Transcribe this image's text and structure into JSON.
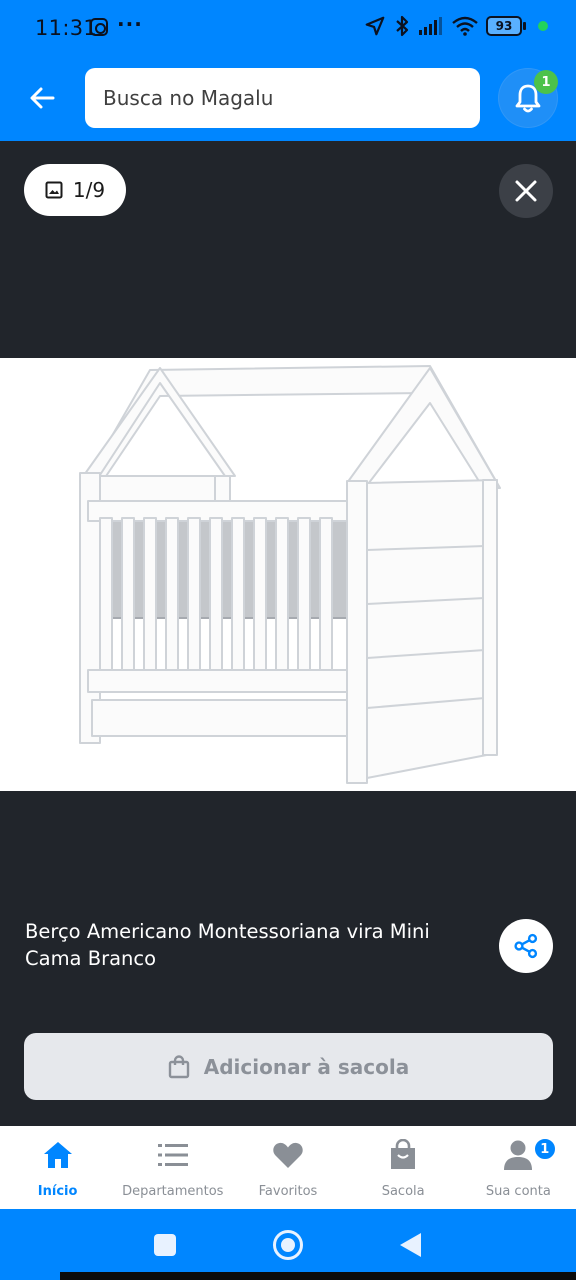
{
  "status_bar": {
    "time": "11:31",
    "overflow_dots": "···",
    "battery_level": "93",
    "icons": [
      "instagram-icon",
      "location-arrow-icon",
      "bluetooth-icon",
      "signal-icon",
      "wifi-icon",
      "battery-icon"
    ]
  },
  "header": {
    "search_placeholder": "Busca no Magalu",
    "notification_count": "1"
  },
  "gallery": {
    "photo_counter": "1/9"
  },
  "product": {
    "title": "Berço Americano Montessoriana vira Mini Cama Branco",
    "add_to_bag_label": "Adicionar à sacola"
  },
  "bottom_nav": {
    "items": [
      {
        "label": "Início",
        "icon": "home-icon",
        "active": true
      },
      {
        "label": "Departamentos",
        "icon": "list-icon"
      },
      {
        "label": "Favoritos",
        "icon": "heart-icon"
      },
      {
        "label": "Sacola",
        "icon": "shopping-bag-icon"
      },
      {
        "label": "Sua conta",
        "icon": "user-icon",
        "badge": "1"
      }
    ]
  },
  "colors": {
    "brand_blue": "#0086ff",
    "dark_background": "#21252b",
    "badge_green": "#4cc24a"
  }
}
